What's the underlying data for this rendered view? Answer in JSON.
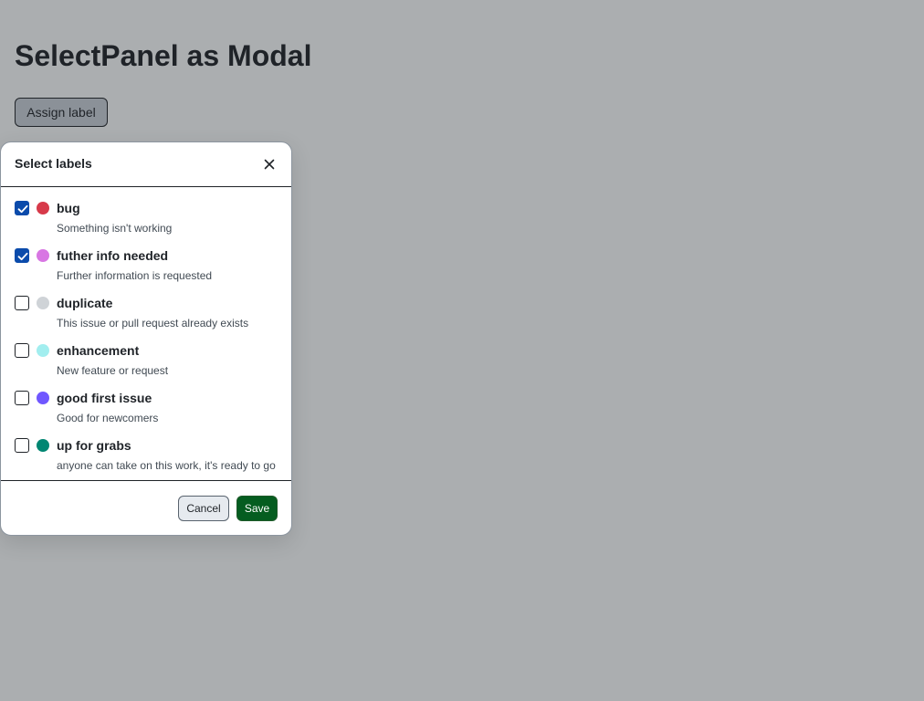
{
  "page": {
    "title": "SelectPanel as Modal",
    "assign_button_label": "Assign label"
  },
  "modal": {
    "title": "Select labels",
    "close_icon": "close-icon",
    "cancel_label": "Cancel",
    "save_label": "Save"
  },
  "labels": [
    {
      "name": "bug",
      "description": "Something isn't working",
      "color": "#d73a4a",
      "checked": true
    },
    {
      "name": "futher info needed",
      "description": "Further information is requested",
      "color": "#d876e3",
      "checked": true
    },
    {
      "name": "duplicate",
      "description": "This issue or pull request already exists",
      "color": "#cfd3d7",
      "checked": false
    },
    {
      "name": "enhancement",
      "description": "New feature or request",
      "color": "#a2eeef",
      "checked": false
    },
    {
      "name": "good first issue",
      "description": "Good for newcomers",
      "color": "#7057ff",
      "checked": false
    },
    {
      "name": "up for grabs",
      "description": "anyone can take on this work, it's ready to go",
      "color": "#008672",
      "checked": false
    }
  ],
  "colors": {
    "backdrop": "#abaeb0",
    "checkbox_checked": "#0b4bab",
    "save_button": "#055d20"
  }
}
